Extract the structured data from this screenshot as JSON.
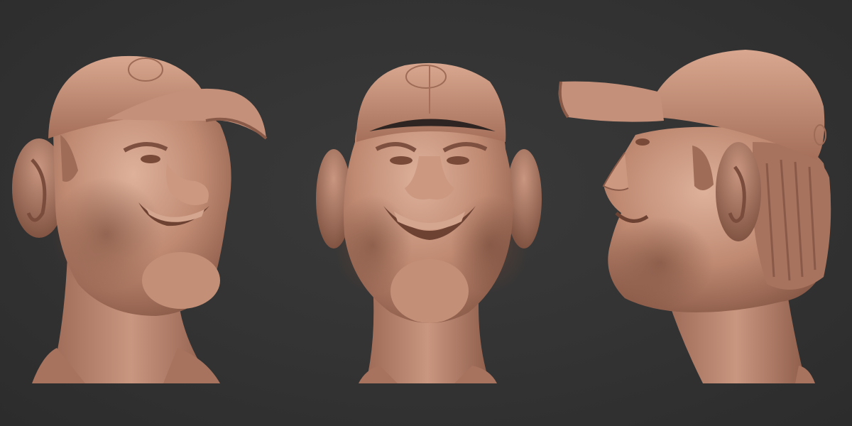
{
  "scene": {
    "background_color": "#333333",
    "clay_color": "#c08a72",
    "clay_shadow_color": "#8a5a48",
    "clay_highlight_color": "#dcae97",
    "views": [
      {
        "id": "three-quarter",
        "facing": "right"
      },
      {
        "id": "front",
        "facing": "viewer"
      },
      {
        "id": "profile",
        "facing": "left"
      }
    ]
  }
}
